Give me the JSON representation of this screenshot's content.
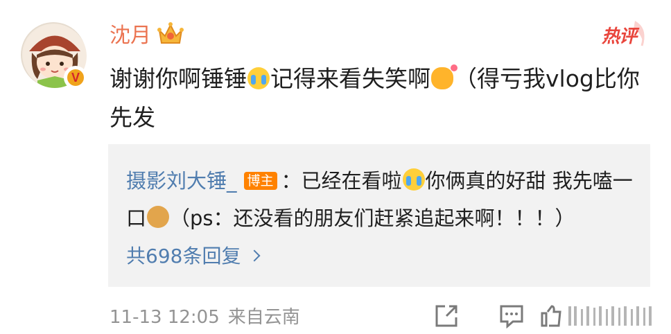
{
  "post": {
    "username": "沈月",
    "hot_label": "热评",
    "content": {
      "part1": "谢谢你啊锤锤",
      "emoji1": "cry-emoji",
      "part2": "记得来看失笑啊",
      "emoji2": "cat-emoji",
      "part3": "（得亏我vlog比你先发"
    },
    "timestamp": "11-13 12:05",
    "source": "来自云南"
  },
  "reply": {
    "author": "摄影刘大锤_",
    "author_tag": "博主",
    "text1": "：已经在看啦",
    "emoji1": "cry-emoji",
    "text2": "你俩真的好甜 我先嗑一口",
    "emoji2": "doge-emoji",
    "text3": "（ps：还没看的朋友们赶紧追起来啊！！！）",
    "more_label": "共698条回复"
  },
  "colors": {
    "username": "#eb7350",
    "link": "#507daf",
    "hot": "#e9453c",
    "tag": "#ff8200",
    "meta": "#939393",
    "reply_bg": "#f2f2f2"
  },
  "icons": [
    "crown-icon",
    "verified-badge-icon",
    "share-icon",
    "comment-icon",
    "like-icon"
  ]
}
